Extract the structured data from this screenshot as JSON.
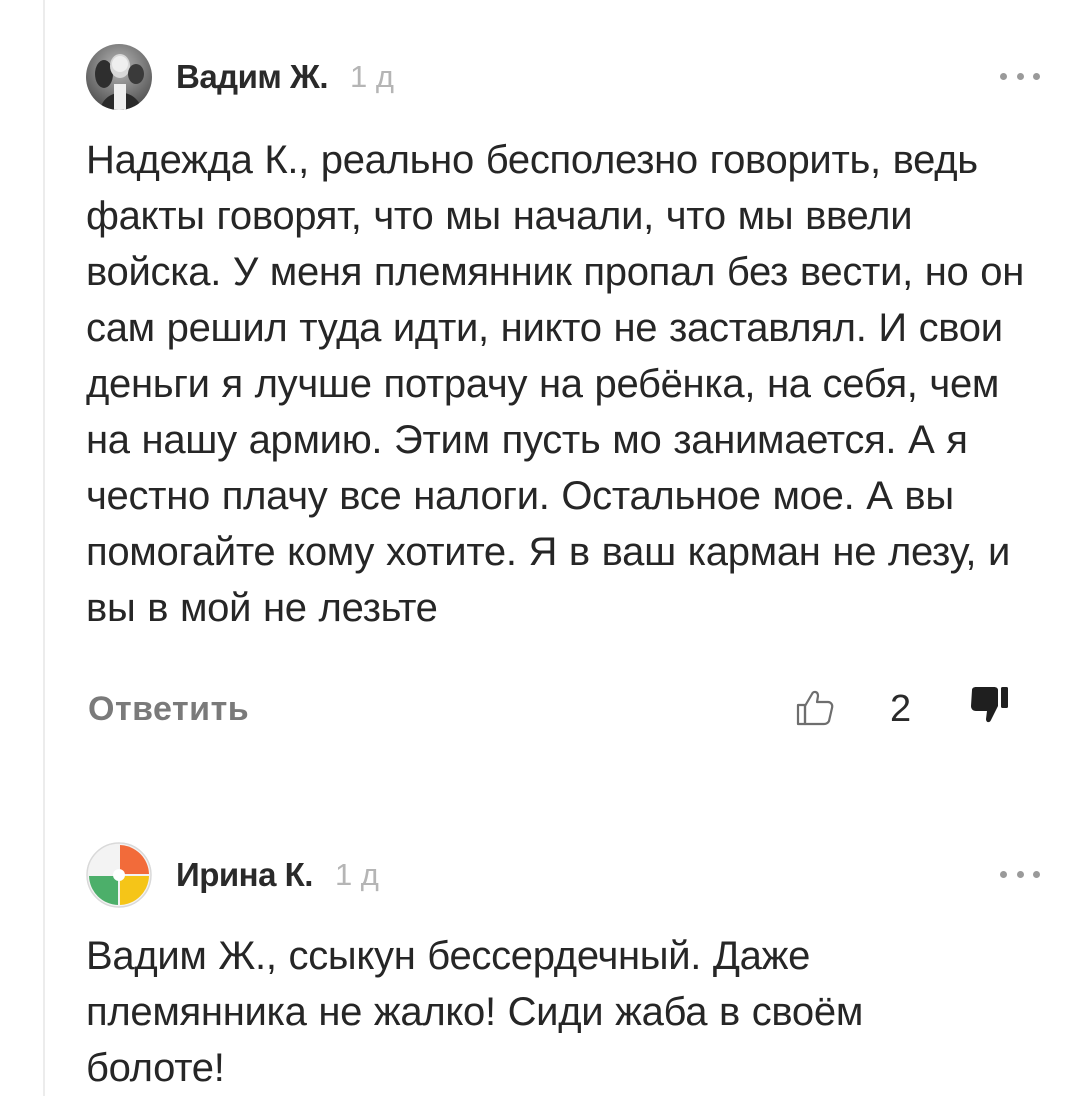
{
  "comments": [
    {
      "author": "Вадим Ж.",
      "time": "1 д",
      "text": "Надежда К., реально бесполезно говорить, ведь факты говорят, что мы начали, что мы ввели войска. У меня племянник пропал без вести, но он сам решил туда идти, никто не заставлял. И свои деньги я лучше потрачу на ребёнка, на себя, чем на нашу армию. Этим пусть мо занимается. А я честно плачу все налоги. Остальное мое. А вы помогайте кому хотите. Я в ваш карман не лезу, и вы в мой не лезьте",
      "reply_label": "Ответить",
      "likes": "2",
      "avatar_icon": "user-photo-avatar",
      "like_icon": "thumbs-up-outline-icon",
      "dislike_icon": "thumbs-down-filled-icon",
      "more_icon": "more-dots-icon"
    },
    {
      "author": "Ирина К.",
      "time": "1 д",
      "text": "Вадим Ж., ссыкун бессердечный. Даже племянника не жалко! Сиди жаба в своём болоте!",
      "avatar_icon": "default-avatar-icon",
      "more_icon": "more-dots-icon"
    }
  ],
  "colors": {
    "text": "#262626",
    "author": "#2a2a2a",
    "time": "#b5b5b5",
    "reply": "#7a7a7a",
    "avatar_red": "#f26b3a",
    "avatar_green": "#4caf6a",
    "avatar_yellow": "#f5c518"
  }
}
